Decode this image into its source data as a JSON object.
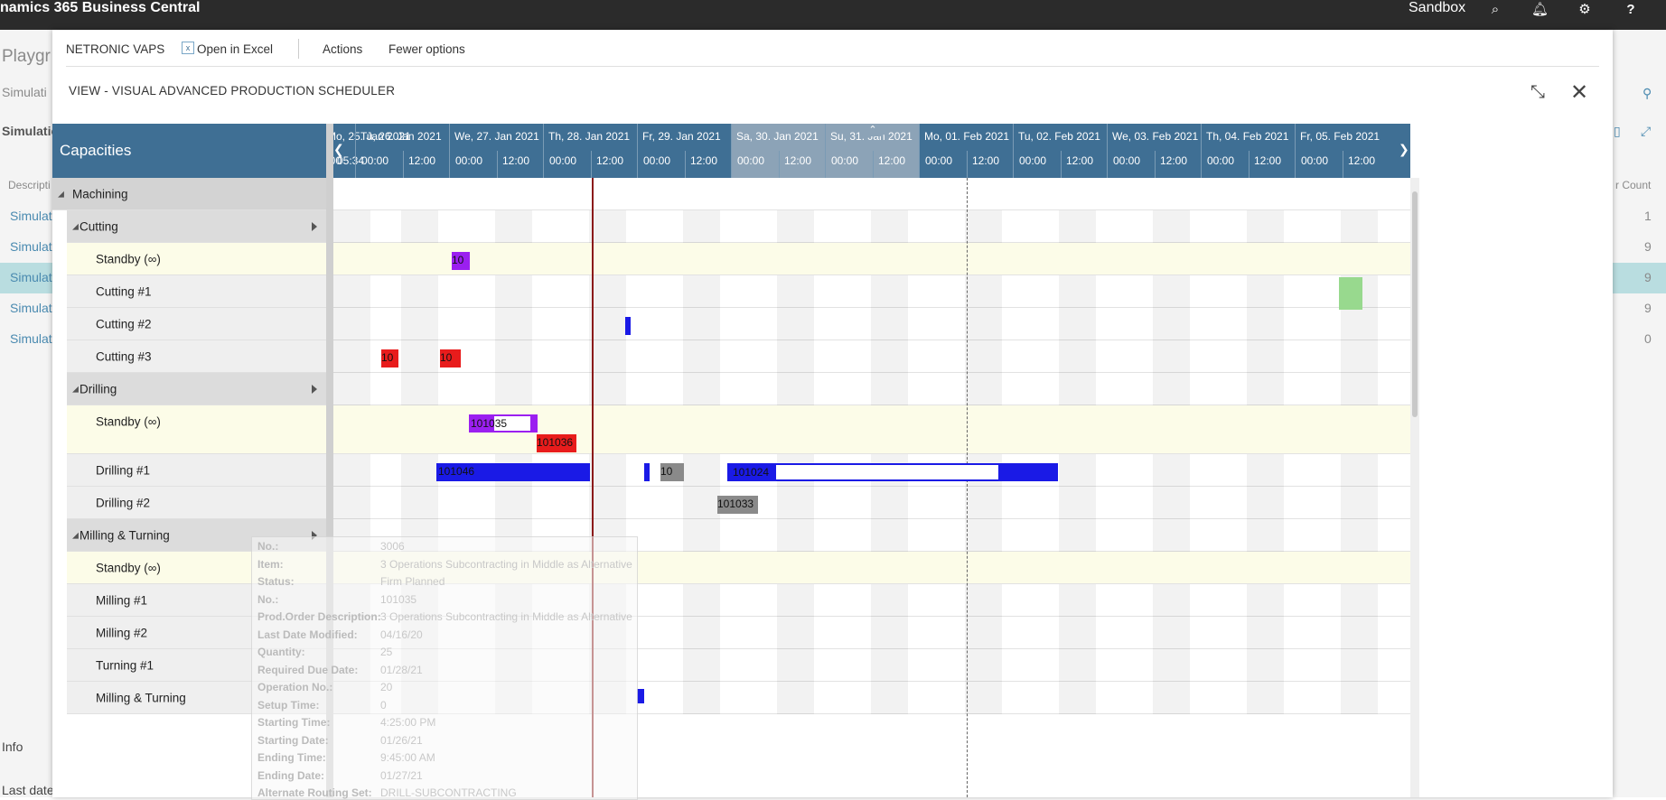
{
  "topbar": {
    "app_title": "namics 365 Business Central",
    "environment": "Sandbox",
    "icons": [
      "search-icon",
      "bell-icon",
      "gear-icon",
      "help-icon"
    ]
  },
  "background": {
    "page_title": "Playgr",
    "breadcrumb": "Simulati",
    "tab": "Simulatio",
    "column_description": "Descripti",
    "rows": [
      "Simulat",
      "Simulat",
      "Simulat",
      "Simulat",
      "Simulat"
    ],
    "column_count_header": "r Count",
    "counts": [
      "1",
      "9",
      "9",
      "9",
      "0"
    ],
    "info_label": "Info",
    "last_date_label": "Last date"
  },
  "dialog": {
    "menu": {
      "netronic": "NETRONIC VAPS",
      "open_excel": "Open in Excel",
      "actions": "Actions",
      "fewer": "Fewer options"
    },
    "title": "VIEW - VISUAL ADVANCED PRODUCTION SCHEDULER",
    "capacities_label": "Capacities",
    "days": [
      {
        "label": "Mo, 25. Jan 2021",
        "weekend": false,
        "h0": "05:34",
        "h1": "12:00"
      },
      {
        "label": "Tu, 26. Jan 2021",
        "weekend": false,
        "h0": "00:00",
        "h1": "12:00"
      },
      {
        "label": "We, 27. Jan 2021",
        "weekend": false,
        "h0": "00:00",
        "h1": "12:00"
      },
      {
        "label": "Th, 28. Jan 2021",
        "weekend": false,
        "h0": "00:00",
        "h1": "12:00"
      },
      {
        "label": "Fr, 29. Jan 2021",
        "weekend": false,
        "h0": "00:00",
        "h1": "12:00"
      },
      {
        "label": "Sa, 30. Jan 2021",
        "weekend": true,
        "h0": "00:00",
        "h1": "12:00"
      },
      {
        "label": "Su, 31. Jan 2021",
        "weekend": true,
        "h0": "00:00",
        "h1": "12:00"
      },
      {
        "label": "Mo, 01. Feb 2021",
        "weekend": false,
        "h0": "00:00",
        "h1": "12:00"
      },
      {
        "label": "Tu, 02. Feb 2021",
        "weekend": false,
        "h0": "00:00",
        "h1": "12:00"
      },
      {
        "label": "We, 03. Feb 2021",
        "weekend": false,
        "h0": "00:00",
        "h1": "12:00"
      },
      {
        "label": "Th, 04. Feb 2021",
        "weekend": false,
        "h0": "00:00",
        "h1": "12:00"
      },
      {
        "label": "Fr, 05. Feb 2021",
        "weekend": false,
        "h0": "00:00",
        "h1": "12:00"
      }
    ],
    "rows": [
      {
        "label": "Machining",
        "kind": "group0"
      },
      {
        "label": "Cutting",
        "kind": "group1"
      },
      {
        "label": "Standby (∞)",
        "kind": "standby"
      },
      {
        "label": "Cutting #1",
        "kind": "res"
      },
      {
        "label": "Cutting #2",
        "kind": "res"
      },
      {
        "label": "Cutting #3",
        "kind": "res"
      },
      {
        "label": "Drilling",
        "kind": "group1"
      },
      {
        "label": "Standby (∞)",
        "kind": "standby2"
      },
      {
        "label": "Drilling #1",
        "kind": "res"
      },
      {
        "label": "Drilling #2",
        "kind": "res"
      },
      {
        "label": "Milling & Turning",
        "kind": "group1"
      },
      {
        "label": "Standby (∞)",
        "kind": "standby"
      },
      {
        "label": "Milling #1",
        "kind": "res"
      },
      {
        "label": "Milling #2",
        "kind": "res"
      },
      {
        "label": "Turning #1",
        "kind": "res"
      },
      {
        "label": "Milling & Turning",
        "kind": "res"
      }
    ],
    "bars": {
      "b1": "10",
      "b2": "10",
      "b3": "10",
      "b4": "101035",
      "b5": "101036",
      "b6": "101046",
      "b7": "10",
      "b8": "101024",
      "b9": "101033"
    },
    "tooltip": [
      {
        "k": "No.:",
        "v": "3006"
      },
      {
        "k": "Item:",
        "v": "3 Operations Subcontracting in Middle as Alternative"
      },
      {
        "k": "Status:",
        "v": "Firm Planned"
      },
      {
        "k": "No.:",
        "v": "101035"
      },
      {
        "k": "Prod.Order Description:",
        "v": "3 Operations Subcontracting in Middle as Alternative"
      },
      {
        "k": "Last Date Modified:",
        "v": "04/16/20"
      },
      {
        "k": "Quantity:",
        "v": "25"
      },
      {
        "k": "Required Due Date:",
        "v": "01/28/21"
      },
      {
        "k": "Operation No.:",
        "v": "20"
      },
      {
        "k": "Setup Time:",
        "v": "0"
      },
      {
        "k": "Starting Time:",
        "v": "4:25:00 PM"
      },
      {
        "k": "Starting Date:",
        "v": "01/26/21"
      },
      {
        "k": "Ending Time:",
        "v": "9:45:00 AM"
      },
      {
        "k": "Ending Date:",
        "v": "01/27/21"
      },
      {
        "k": "Alternate Routing Set:",
        "v": "DRILL-SUBCONTRACTING"
      }
    ]
  }
}
